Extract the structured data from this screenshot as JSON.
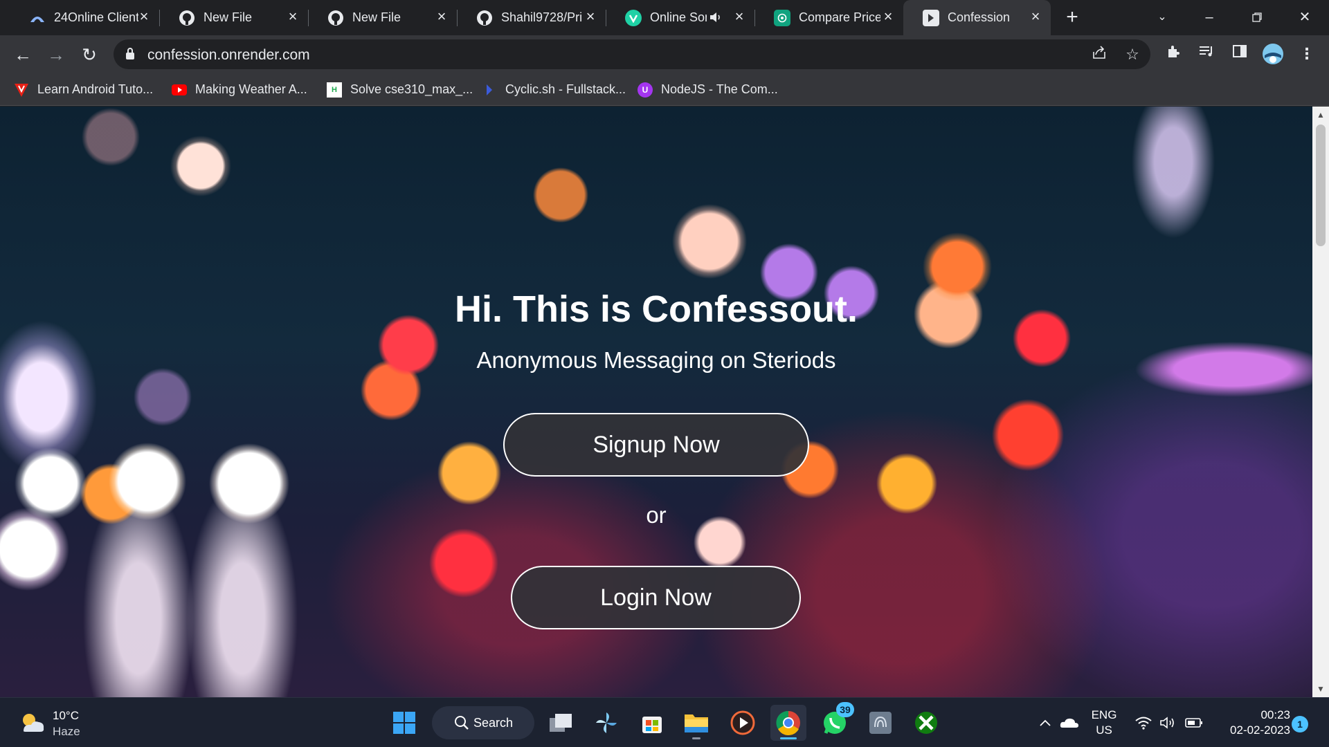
{
  "tabs": [
    {
      "title": "24Online Client",
      "icon": "24online-icon"
    },
    {
      "title": "New File",
      "icon": "github-icon"
    },
    {
      "title": "New File",
      "icon": "github-icon"
    },
    {
      "title": "Shahil9728/Pri",
      "icon": "github-icon"
    },
    {
      "title": "Online Son",
      "icon": "online-songs-icon"
    },
    {
      "title": "Compare Price",
      "icon": "chatgpt-icon"
    },
    {
      "title": "Confession",
      "icon": "confession-icon"
    }
  ],
  "active_tab": "Confession",
  "address_bar": {
    "url": "confession.onrender.com"
  },
  "bookmarks": [
    {
      "label": "Learn Android Tuto...",
      "icon": "red-v-icon"
    },
    {
      "label": "Making Weather A...",
      "icon": "youtube-icon"
    },
    {
      "label": "Solve cse310_max_...",
      "icon": "hackerrank-icon"
    },
    {
      "label": "Cyclic.sh - Fullstack...",
      "icon": "cyclic-icon"
    },
    {
      "label": "NodeJS - The Com...",
      "icon": "udemy-icon"
    }
  ],
  "page": {
    "title": "Hi. This is Confessout.",
    "subtitle": "Anonymous Messaging on Steriods",
    "signup_label": "Signup Now",
    "or_label": "or",
    "login_label": "Login Now"
  },
  "taskbar": {
    "weather": {
      "temp": "10°C",
      "condition": "Haze"
    },
    "search_label": "Search",
    "whatsapp_badge": "39",
    "language": {
      "line1": "ENG",
      "line2": "US"
    },
    "clock": {
      "time": "00:23",
      "date": "02-02-2023"
    },
    "notification_count": "1"
  },
  "colors": {
    "tabstrip_bg": "#202124",
    "toolbar_bg": "#35363a",
    "button_bg": "#323237",
    "taskbar_bg": "#1c2230",
    "accent": "#4cc2ff"
  }
}
